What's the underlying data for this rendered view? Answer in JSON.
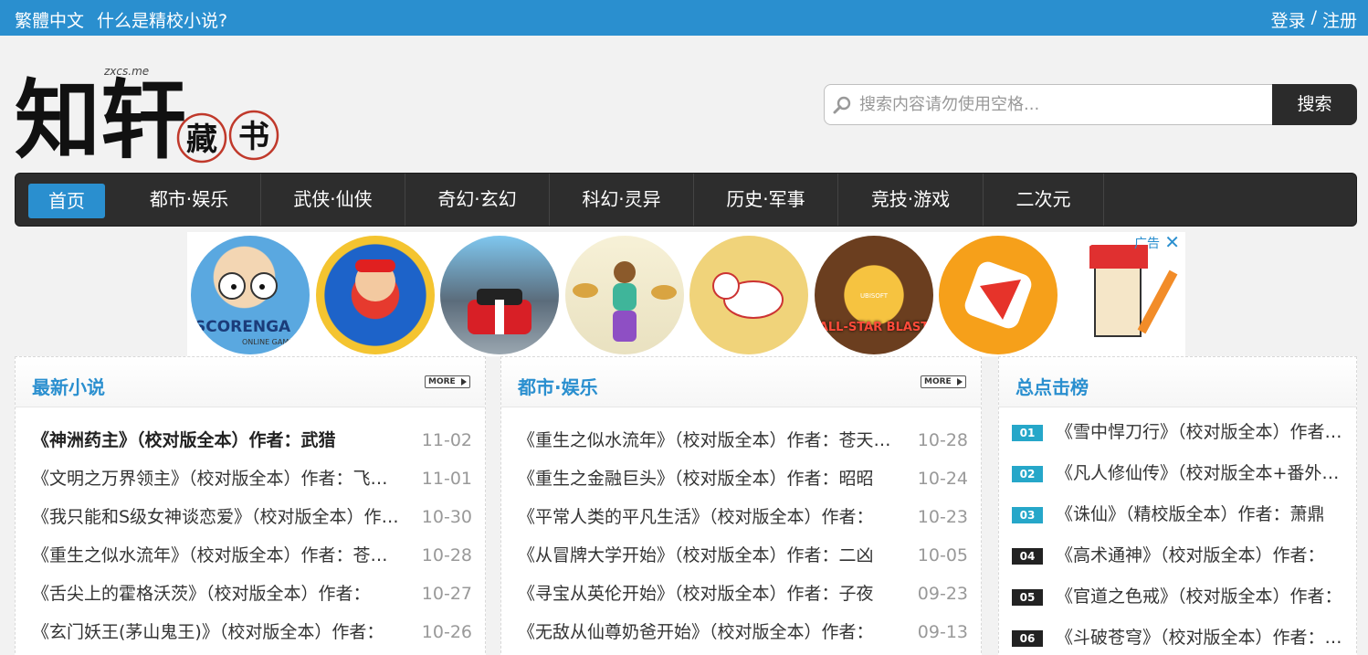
{
  "topbar": {
    "traditional": "繁體中文",
    "about": "什么是精校小说?",
    "login": "登录",
    "sep": "/",
    "register": "注册"
  },
  "logo": {
    "main": "知轩",
    "domain": "zxcs.me",
    "seal1": "藏",
    "seal2": "书"
  },
  "search": {
    "placeholder": "搜索内容请勿使用空格...",
    "button": "搜索"
  },
  "nav": {
    "items": [
      "首页",
      "都市·娱乐",
      "武侠·仙侠",
      "奇幻·玄幻",
      "科幻·灵异",
      "历史·军事",
      "竞技·游戏",
      "二次元"
    ]
  },
  "ad": {
    "label": "广告",
    "close": "✕",
    "brand": "SCORENGA",
    "brand_sub": "ONLINE GAMES",
    "game5": "ALL-STAR BLAST",
    "game5_pub": "UBISOFT",
    "colors": {
      "accent": "#2a8fcf"
    }
  },
  "panels": {
    "latest": {
      "title": "最新小说",
      "more": "MORE",
      "items": [
        {
          "name": "《神洲药主》（校对版全本）作者：武猎",
          "date": "11-02"
        },
        {
          "name": "《文明之万界领主》（校对版全本）作者：飞翔的猪",
          "date": "11-01"
        },
        {
          "name": "《我只能和S级女神谈恋爱》（校对版全本）作者：",
          "date": "10-30"
        },
        {
          "name": "《重生之似水流年》（校对版全本）作者：苍天白鹤",
          "date": "10-28"
        },
        {
          "name": "《舌尖上的霍格沃茨》（校对版全本）作者：",
          "date": "10-27"
        },
        {
          "name": "《玄门妖王(茅山鬼王)》（校对版全本）作者：",
          "date": "10-26"
        }
      ]
    },
    "urban": {
      "title": "都市·娱乐",
      "more": "MORE",
      "items": [
        {
          "name": "《重生之似水流年》（校对版全本）作者：苍天白鹤",
          "date": "10-28"
        },
        {
          "name": "《重生之金融巨头》（校对版全本）作者：昭昭",
          "date": "10-24"
        },
        {
          "name": "《平常人类的平凡生活》（校对版全本）作者：",
          "date": "10-23"
        },
        {
          "name": "《从冒牌大学开始》（校对版全本）作者：二凶",
          "date": "10-05"
        },
        {
          "name": "《寻宝从英伦开始》（校对版全本）作者：子夜",
          "date": "09-23"
        },
        {
          "name": "《无敌从仙尊奶爸开始》（校对版全本）作者：",
          "date": "09-13"
        }
      ]
    },
    "rank": {
      "title": "总点击榜",
      "items": [
        {
          "num": "01",
          "name": "《雪中悍刀行》（校对版全本）作者：烽火戏诸侯"
        },
        {
          "num": "02",
          "name": "《凡人修仙传》（校对版全本+番外）作者：忘语"
        },
        {
          "num": "03",
          "name": "《诛仙》（精校版全本）作者：萧鼎"
        },
        {
          "num": "04",
          "name": "《高术通神》（校对版全本）作者："
        },
        {
          "num": "05",
          "name": "《官道之色戒》（校对版全本）作者："
        },
        {
          "num": "06",
          "name": "《斗破苍穹》（校对版全本）作者：天蚕土豆"
        }
      ]
    }
  }
}
